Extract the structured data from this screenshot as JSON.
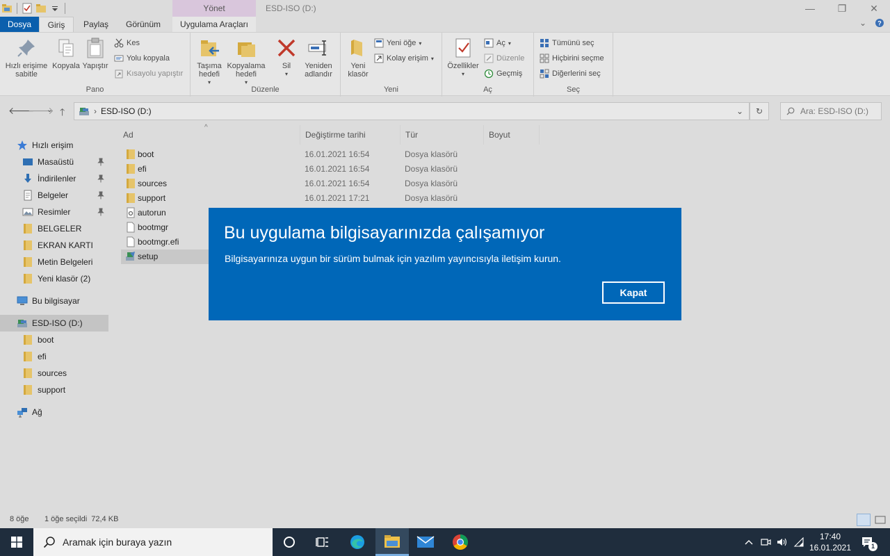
{
  "window": {
    "title": "ESD-ISO (D:)",
    "contextual_tab_group": "Yönet",
    "minimize": "—",
    "maximize": "❐",
    "close": "✕"
  },
  "tabs": {
    "file": "Dosya",
    "home": "Giriş",
    "share": "Paylaş",
    "view": "Görünüm",
    "app_tools": "Uygulama Araçları"
  },
  "ribbon": {
    "clipboard": {
      "label": "Pano",
      "pin_quick": "Hızlı erişime sabitle",
      "copy": "Kopyala",
      "paste": "Yapıştır",
      "cut": "Kes",
      "copy_path": "Yolu kopyala",
      "paste_shortcut": "Kısayolu yapıştır"
    },
    "organize": {
      "label": "Düzenle",
      "move_to": "Taşıma hedefi",
      "copy_to": "Kopyalama hedefi",
      "delete": "Sil",
      "rename": "Yeniden adlandır"
    },
    "new": {
      "label": "Yeni",
      "new_folder": "Yeni klasör",
      "new_item": "Yeni öğe",
      "easy_access": "Kolay erişim"
    },
    "open": {
      "label": "Aç",
      "properties": "Özellikler",
      "open": "Aç",
      "edit": "Düzenle",
      "history": "Geçmiş"
    },
    "select": {
      "label": "Seç",
      "select_all": "Tümünü seç",
      "select_none": "Hiçbirini seçme",
      "invert": "Diğerlerini seç"
    }
  },
  "address": {
    "path": "ESD-ISO (D:)",
    "search_placeholder": "Ara: ESD-ISO (D:)"
  },
  "nav": {
    "quick_access": "Hızlı erişim",
    "items": [
      "Masaüstü",
      "İndirilenler",
      "Belgeler",
      "Resimler",
      "BELGELER",
      "EKRAN KARTI",
      "Metin Belgeleri",
      "Yeni klasör (2)"
    ],
    "this_pc": "Bu bilgisayar",
    "drive": "ESD-ISO (D:)",
    "drive_children": [
      "boot",
      "efi",
      "sources",
      "support"
    ],
    "network": "Ağ"
  },
  "columns": {
    "name": "Ad",
    "modified": "Değiştirme tarihi",
    "type": "Tür",
    "size": "Boyut"
  },
  "files": [
    {
      "name": "boot",
      "modified": "16.01.2021 16:54",
      "type": "Dosya klasörü"
    },
    {
      "name": "efi",
      "modified": "16.01.2021 16:54",
      "type": "Dosya klasörü"
    },
    {
      "name": "sources",
      "modified": "16.01.2021 16:54",
      "type": "Dosya klasörü"
    },
    {
      "name": "support",
      "modified": "16.01.2021 17:21",
      "type": "Dosya klasörü"
    },
    {
      "name": "autorun",
      "modified": "",
      "type": ""
    },
    {
      "name": "bootmgr",
      "modified": "",
      "type": ""
    },
    {
      "name": "bootmgr.efi",
      "modified": "",
      "type": ""
    },
    {
      "name": "setup",
      "modified": "",
      "type": ""
    }
  ],
  "status": {
    "count": "8 öğe",
    "selected": "1 öğe seçildi  72,4 KB"
  },
  "dialog": {
    "title": "Bu uygulama bilgisayarınızda çalışamıyor",
    "message": "Bilgisayarınıza uygun bir sürüm bulmak için yazılım yayıncısıyla iletişim kurun.",
    "close_button": "Kapat"
  },
  "taskbar": {
    "search_placeholder": "Aramak için buraya yazın",
    "time": "17:40",
    "date": "16.01.2021",
    "notification_count": "1"
  },
  "colors": {
    "dialog_bg": "#0067b8",
    "file_tab": "#0b5fad",
    "taskbar": "#1f2d3d",
    "context_tab": "#d9c6dc",
    "folder": "#e6c46a"
  }
}
